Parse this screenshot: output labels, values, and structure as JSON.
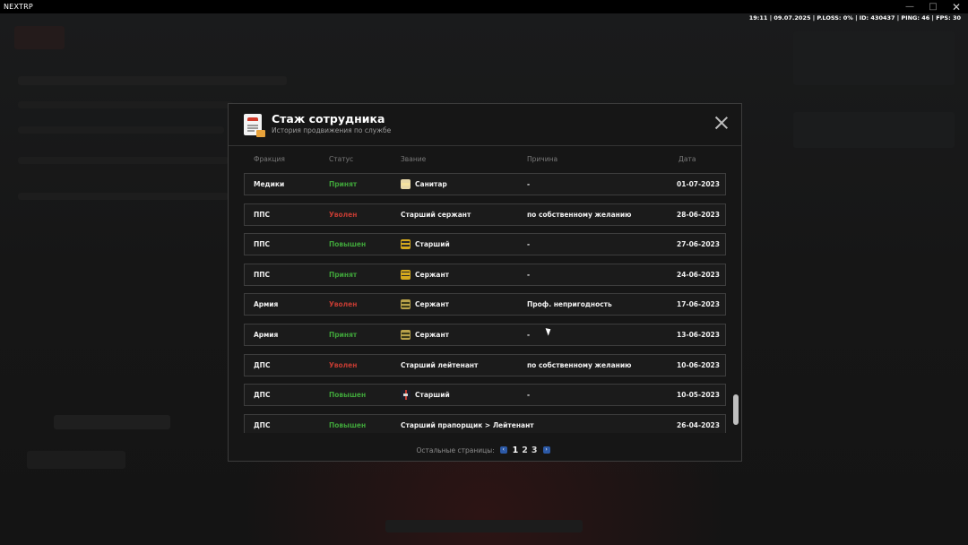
{
  "window": {
    "title": "NEXTRP",
    "minimize_glyph": "—",
    "maximize_glyph": "□",
    "close_glyph": "✕"
  },
  "hud": {
    "status_line": "19:11 | 09.07.2025 | P.LOSS: 0% | ID: 430437 | PING: 46 | FPS: 30"
  },
  "modal": {
    "title": "Стаж сотрудника",
    "subtitle": "История продвижения по службе",
    "columns": {
      "faction": "Фракция",
      "status": "Статус",
      "rank": "Звание",
      "reason": "Причина",
      "date": "Дата"
    },
    "rows": [
      {
        "faction": "Медики",
        "status": "Принят",
        "status_kind": "accepted",
        "rank": "Санитар",
        "rank_icon": "medic-rank-icon",
        "reason": "-",
        "date": "01-07-2023"
      },
      {
        "faction": "ППС",
        "status": "Уволен",
        "status_kind": "fired",
        "rank": "Старший сержант",
        "rank_icon": "",
        "reason": "по собственному желанию",
        "date": "28-06-2023"
      },
      {
        "faction": "ППС",
        "status": "Повышен",
        "status_kind": "promoted",
        "rank": "Старший",
        "rank_icon": "police-rank-icon",
        "reason": "-",
        "date": "27-06-2023"
      },
      {
        "faction": "ППС",
        "status": "Принят",
        "status_kind": "accepted",
        "rank": "Сержант",
        "rank_icon": "police-rank-icon",
        "reason": "-",
        "date": "24-06-2023"
      },
      {
        "faction": "Армия",
        "status": "Уволен",
        "status_kind": "fired",
        "rank": "Сержант",
        "rank_icon": "army-rank-icon",
        "reason": "Проф. непригодность",
        "date": "17-06-2023"
      },
      {
        "faction": "Армия",
        "status": "Принят",
        "status_kind": "accepted",
        "rank": "Сержант",
        "rank_icon": "army-rank-icon",
        "reason": "-",
        "date": "13-06-2023"
      },
      {
        "faction": "ДПС",
        "status": "Уволен",
        "status_kind": "fired",
        "rank": "Старший лейтенант",
        "rank_icon": "",
        "reason": "по собственному желанию",
        "date": "10-06-2023"
      },
      {
        "faction": "ДПС",
        "status": "Повышен",
        "status_kind": "promoted",
        "rank": "Старший",
        "rank_icon": "traffic-rank-icon",
        "reason": "-",
        "date": "10-05-2023"
      },
      {
        "faction": "ДПС",
        "status": "Повышен",
        "status_kind": "promoted",
        "rank": "Старший прапорщик > Лейтенант",
        "rank_icon": "",
        "reason": "-",
        "date": "26-04-2023"
      }
    ],
    "pagination": {
      "label": "Остальные страницы:",
      "prev_glyph": "‹",
      "next_glyph": "›",
      "pages": [
        "1",
        "2",
        "3"
      ],
      "current": "1"
    }
  },
  "colors": {
    "accepted": "#3fa33a",
    "promoted": "#3fa33a",
    "fired": "#c23b32",
    "pager_arrow": "#2c59a6"
  }
}
